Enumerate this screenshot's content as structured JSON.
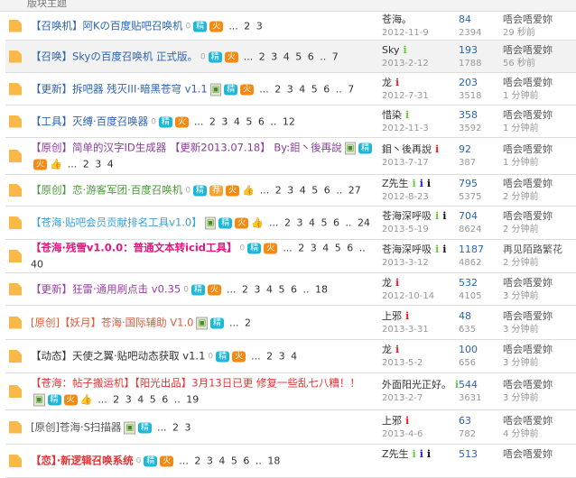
{
  "header": {
    "label": "版块主题"
  },
  "colors": {
    "jing": "#1eb7d8",
    "huo": "#f58a12",
    "folder": "#f9b94a"
  },
  "rows": [
    {
      "title": "【召唤机】阿Kの百度贴吧召唤机",
      "color": "#2d64b3",
      "badges": [
        "clip",
        "jing",
        "huo"
      ],
      "pages": "... 2 3",
      "author": "苍海。",
      "icons": [],
      "date": "2012-11-9",
      "replies": "84",
      "views": "2394",
      "last_user": "唔会唔爱妳",
      "last_time": "29 秒前",
      "h": 31
    },
    {
      "title": "【召唤】Skyの百度召唤机 正式版。",
      "color": "#2d64b3",
      "badges": [
        "clip",
        "jing",
        "huo"
      ],
      "pages": "... 2 3 4 5 6 .. 7",
      "author": "Sky",
      "icons": [
        "#6c3"
      ],
      "date": "2013-2-12",
      "replies": "193",
      "views": "1788",
      "last_user": "唔会唔爱妳",
      "last_time": "56 秒前",
      "h": 35,
      "hl": true
    },
    {
      "title": "【更新】拆吧器 残灭III·暗黑苍穹 v1.1",
      "color": "#2d64b3",
      "badges": [
        "img",
        "jing",
        "huo"
      ],
      "pages": "... 2 3 4 5 6 .. 7",
      "author": "龙",
      "icons": [
        "#e22"
      ],
      "date": "2012-7-31",
      "replies": "203",
      "views": "3518",
      "last_user": "唔会唔爱妳",
      "last_time": "1 分钟前",
      "h": 35
    },
    {
      "title": "【工具】灭缚·百度召唤器",
      "color": "#2d64b3",
      "badges": [
        "clip",
        "jing",
        "huo"
      ],
      "pages": "... 2 3 4 5 6 .. 12",
      "author": "惜染",
      "icons": [
        "#6c3"
      ],
      "date": "2012-11-3",
      "replies": "358",
      "views": "3592",
      "last_user": "唔会唔爱妳",
      "last_time": "1 分钟前",
      "h": 35
    },
    {
      "title": "【原创】简单的汉字ID生成器 【更新2013.07.18】 By:鉬丶後再說",
      "color": "#8b3c9e",
      "badges": [
        "img",
        "jing",
        "huo",
        "thumb"
      ],
      "pages": "... 2 3 4",
      "author": "鉬丶後再說",
      "icons": [
        "#e22"
      ],
      "date": "2013-7-17",
      "replies": "92",
      "views": "387",
      "last_user": "唔会唔爱妳",
      "last_time": "1 分钟前",
      "h": 40
    },
    {
      "title": "【原创】恋·游客军团·百度召唤机",
      "color": "#4a9a3a",
      "badges": [
        "clip",
        "jing",
        "jian",
        "huo",
        "thumb"
      ],
      "pages": "... 2 3 4 5 6 .. 27",
      "author": "Z先生",
      "icons": [
        "#6c3",
        "#22d",
        "#111"
      ],
      "date": "2012-8-23",
      "replies": "795",
      "views": "5375",
      "last_user": "唔会唔爱妳",
      "last_time": "2 分钟前",
      "h": 34
    },
    {
      "title": "【苍海·贴吧会员贡献排名工具v1.0】",
      "color": "#3aa0d8",
      "badges": [
        "img",
        "jing",
        "huo",
        "thumb"
      ],
      "pages": "... 2 3 4 5 6 .. 24",
      "author": "苍海深呼吸",
      "icons": [
        "#6c3",
        "#111"
      ],
      "date": "2013-5-19",
      "replies": "704",
      "views": "8624",
      "last_user": "唔会唔爱妳",
      "last_time": "2 分钟前",
      "h": 36
    },
    {
      "title": "【苍海·残雪v1.0.0：普通文本转icid工具】",
      "color": "#e6157f",
      "bold": true,
      "badges": [
        "clip",
        "jing",
        "huo"
      ],
      "pages": "... 2 3 4 5 6 .. 40",
      "author": "苍海深呼吸",
      "icons": [
        "#6c3",
        "#111"
      ],
      "date": "2013-3-12",
      "replies": "1187",
      "views": "4862",
      "last_user": "再见陌路繁花",
      "last_time": "2 分钟前",
      "h": 36
    },
    {
      "title": "【更新】狂雷·通用刷点击 v0.35",
      "color": "#9b3ca8",
      "badges": [
        "clip",
        "jing",
        "huo"
      ],
      "pages": "... 2 3 4 5 6 .. 18",
      "author": "龙",
      "icons": [
        "#e22"
      ],
      "date": "2012-10-14",
      "replies": "532",
      "views": "4105",
      "last_user": "唔会唔爱妳",
      "last_time": "3 分钟前",
      "h": 35
    },
    {
      "title": "[原创]【妖月】苍海·国际辅助 V1.0",
      "color": "#e05a3a",
      "badges": [
        "img",
        "jing"
      ],
      "pages": "... 2",
      "author": "上邪",
      "icons": [
        "#e22"
      ],
      "date": "2013-3-31",
      "replies": "48",
      "views": "635",
      "last_user": "唔会唔爱妳",
      "last_time": "3 分钟前",
      "h": 37
    },
    {
      "title": "【动态】天使之翼·贴吧动态获取 v1.1",
      "color": "#333333",
      "badges": [
        "clip",
        "jing",
        "huo"
      ],
      "pages": "... 2 3 4",
      "author": "龙",
      "icons": [
        "#e22"
      ],
      "date": "2013-5-2",
      "replies": "100",
      "views": "656",
      "last_user": "唔会唔爱妳",
      "last_time": "3 分钟前",
      "h": 36
    },
    {
      "title": "【苍海：帖子搬运机】【阳光出品】3月13日已更 修复一些乱七八糟！！",
      "color": "#e53333",
      "badges": [
        "img",
        "jing",
        "huo",
        "thumb"
      ],
      "pages": "... 2 3 4 5 6 .. 19",
      "author": "外面阳光正好。",
      "icons": [
        "#6c3"
      ],
      "date": "2013-2-7",
      "replies": "544",
      "views": "3631",
      "last_user": "唔会唔爱妳",
      "last_time": "3 分钟前",
      "h": 40
    },
    {
      "title": "[原创]苍海·S扫描器",
      "color": "#555555",
      "badges": [
        "img",
        "jing"
      ],
      "pages": "... 2 3",
      "author": "上邪",
      "icons": [
        "#e22"
      ],
      "date": "2013-4-6",
      "replies": "63",
      "views": "782",
      "last_user": "唔会唔爱妳",
      "last_time": "4 分钟前",
      "h": 37
    },
    {
      "title": "【恋】·新逻辑召唤系统",
      "color": "#e53333",
      "bold": true,
      "badges": [
        "clip",
        "jing",
        "huo"
      ],
      "pages": "... 2 3 4 5 6 .. 18",
      "author": "Z先生",
      "icons": [
        "#6c3",
        "#22d",
        "#111"
      ],
      "date": "",
      "replies": "513",
      "views": "",
      "last_user": "唔会唔爱妳",
      "last_time": "",
      "h": 36
    }
  ],
  "badge_labels": {
    "jing": "精",
    "huo": "火",
    "jian": "荐",
    "clip": "0",
    "img": "▣",
    "thumb": "👍"
  }
}
